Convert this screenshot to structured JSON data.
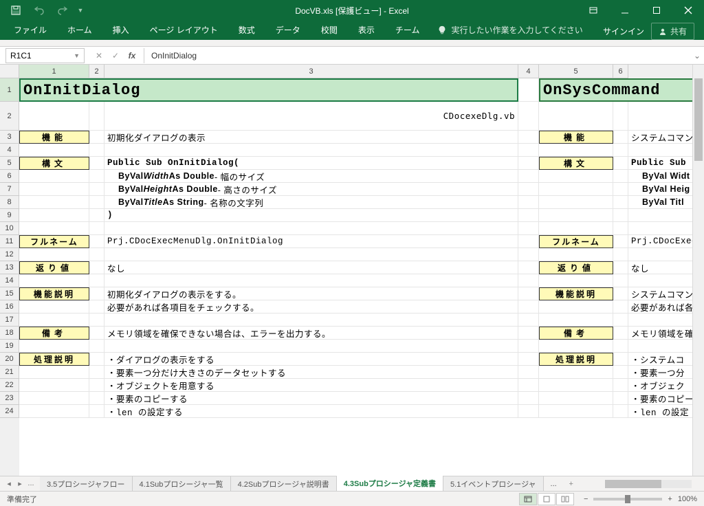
{
  "title": "DocVB.xls  [保護ビュー] - Excel",
  "qat": {
    "save": "保存",
    "undo": "元に戻す",
    "redo": "やり直し",
    "customize": "クイックアクセスツールバーのカスタマイズ"
  },
  "tabs": [
    "ファイル",
    "ホーム",
    "挿入",
    "ページ レイアウト",
    "数式",
    "データ",
    "校閲",
    "表示",
    "チーム"
  ],
  "tell_me": "実行したい作業を入力してください",
  "signin": "サインイン",
  "share": "共有",
  "name_box": "R1C1",
  "formula": "OnInitDialog",
  "col_headers": [
    "1",
    "2",
    "3",
    "4",
    "5",
    "6"
  ],
  "row_headers": [
    "1",
    "2",
    "3",
    "4",
    "5",
    "6",
    "7",
    "8",
    "9",
    "10",
    "11",
    "12",
    "13",
    "14",
    "15",
    "16",
    "17",
    "18",
    "19",
    "20",
    "21",
    "22",
    "23",
    "24"
  ],
  "left": {
    "title": "OnInitDialog",
    "file": "CDocexeDlg.vb",
    "l_func": "機能",
    "v_func": "初期化ダイアログの表示",
    "l_syntax": "構文",
    "syntax_0": "Public Sub OnInitDialog(",
    "syntax_1a": "ByVal ",
    "syntax_1b": "Width",
    "syntax_1c": "   As Double",
    "syntax_1d": " - 幅のサイズ",
    "syntax_2a": "ByVal ",
    "syntax_2b": "Height",
    "syntax_2c": "  As Double",
    "syntax_2d": " - 高さのサイズ",
    "syntax_3a": "ByVal ",
    "syntax_3b": "Title",
    "syntax_3c": "   As String",
    "syntax_3d": " - 名称の文字列",
    "syntax_4": ")",
    "l_full": "フルネーム",
    "v_full": "Prj.CDocExecMenuDlg.OnInitDialog",
    "l_ret": "返り値",
    "v_ret": "なし",
    "l_desc": "機能説明",
    "v_desc1": "初期化ダイアログの表示をする。",
    "v_desc2": "必要があれば各項目をチェックする。",
    "l_note": "備考",
    "v_note": "メモリ領域を確保できない場合は、エラーを出力する。",
    "l_proc": "処理説明",
    "p1": "・ダイアログの表示をする",
    "p2": "・要素一つ分だけ大きさのデータセットする",
    "p3": "・オブジェクトを用意する",
    "p4": "・要素のコピーする",
    "p5": "・len の設定する"
  },
  "right": {
    "title": "OnSysCommand",
    "l_func": "機能",
    "v_func": "システムコマン",
    "l_syntax": "構文",
    "syntax_0": "Public Sub ",
    "syntax_1": "ByVal Widt",
    "syntax_2": "ByVal Heig",
    "syntax_3": "ByVal Titl",
    "l_full": "フルネーム",
    "v_full": "Prj.CDocExecM",
    "l_ret": "返り値",
    "v_ret": "なし",
    "l_desc": "機能説明",
    "v_desc1": "システムコマン",
    "v_desc2": "必要があれば各",
    "l_note": "備考",
    "v_note": "メモリ領域を確",
    "l_proc": "処理説明",
    "p1": "・システムコ",
    "p2": "・要素一つ分",
    "p3": "・オブジェク",
    "p4": "・要素のコピー",
    "p5": "・len の設定"
  },
  "sheets": {
    "nav_dots": "...",
    "t1": "3.5プロシージャフロー",
    "t2": "4.1Subプロシージャ一覧",
    "t3": "4.2Subプロシージャ説明書",
    "t4": "4.3Subプロシージャ定義書",
    "t5": "5.1イベントプロシージャ",
    "dots": "...",
    "add": "+"
  },
  "status": "準備完了",
  "zoom": "100%"
}
